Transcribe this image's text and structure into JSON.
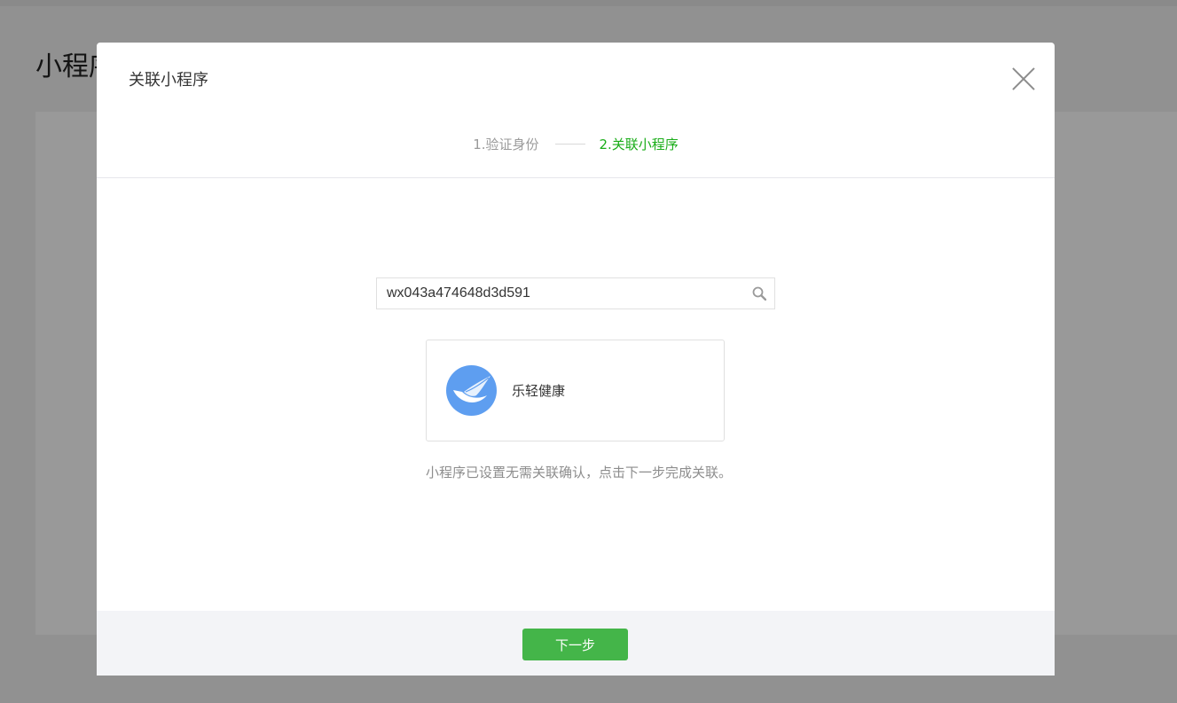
{
  "background": {
    "page_title": "小程序"
  },
  "dialog": {
    "title": "关联小程序",
    "steps": [
      {
        "label": "1.验证身份",
        "state": "done"
      },
      {
        "label": "2.关联小程序",
        "state": "active"
      }
    ],
    "search": {
      "value": "wx043a474648d3d591",
      "placeholder": ""
    },
    "result": {
      "app_name": "乐轻健康",
      "avatar_icon": "feather-bird-icon"
    },
    "tip": "小程序已设置无需关联确认，点击下一步完成关联。",
    "next_label": "下一步"
  },
  "colors": {
    "accent_green": "#1aad19",
    "button_green": "#44b549",
    "avatar_blue": "#5e9ef0"
  }
}
